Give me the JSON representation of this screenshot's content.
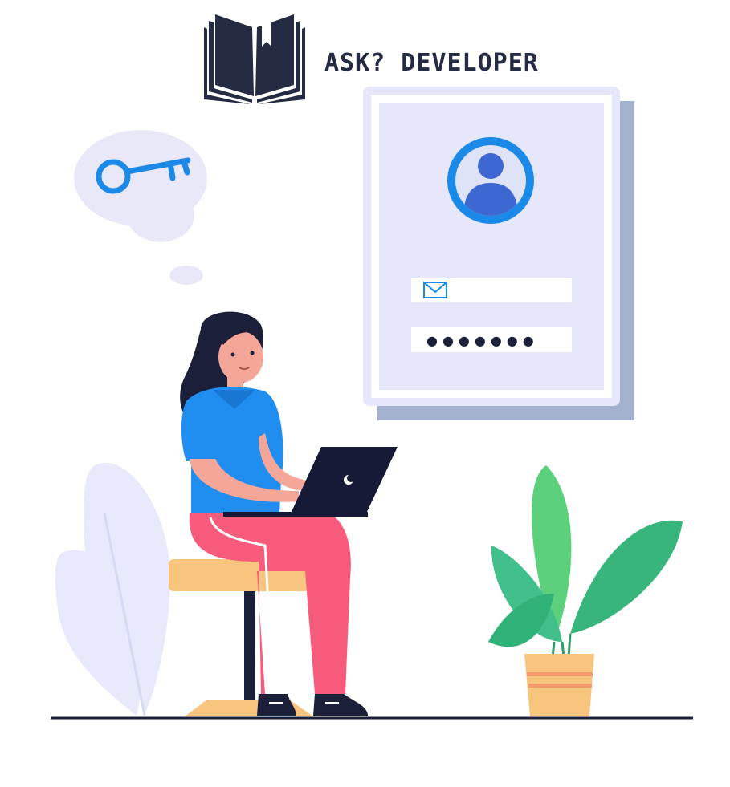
{
  "brand": {
    "name": "ASK? DEVELOPER",
    "logo_icon": "open-book-icon"
  },
  "login_card": {
    "avatar_icon": "user-avatar-icon",
    "email_field_icon": "envelope-icon",
    "email_value": "",
    "password_mask": "●●●●●●●"
  },
  "thought_bubble": {
    "icon": "key-icon"
  },
  "colors": {
    "brand_navy": "#262b44",
    "card_bg": "#e6e7fa",
    "card_shadow": "#a4b1cf",
    "accent_blue": "#1b89e8",
    "shirt": "#1f8ef0",
    "pants": "#f75b7c",
    "stool": "#f8c57e",
    "plant_green": "#3bbf82",
    "pot": "#f8c57e"
  }
}
